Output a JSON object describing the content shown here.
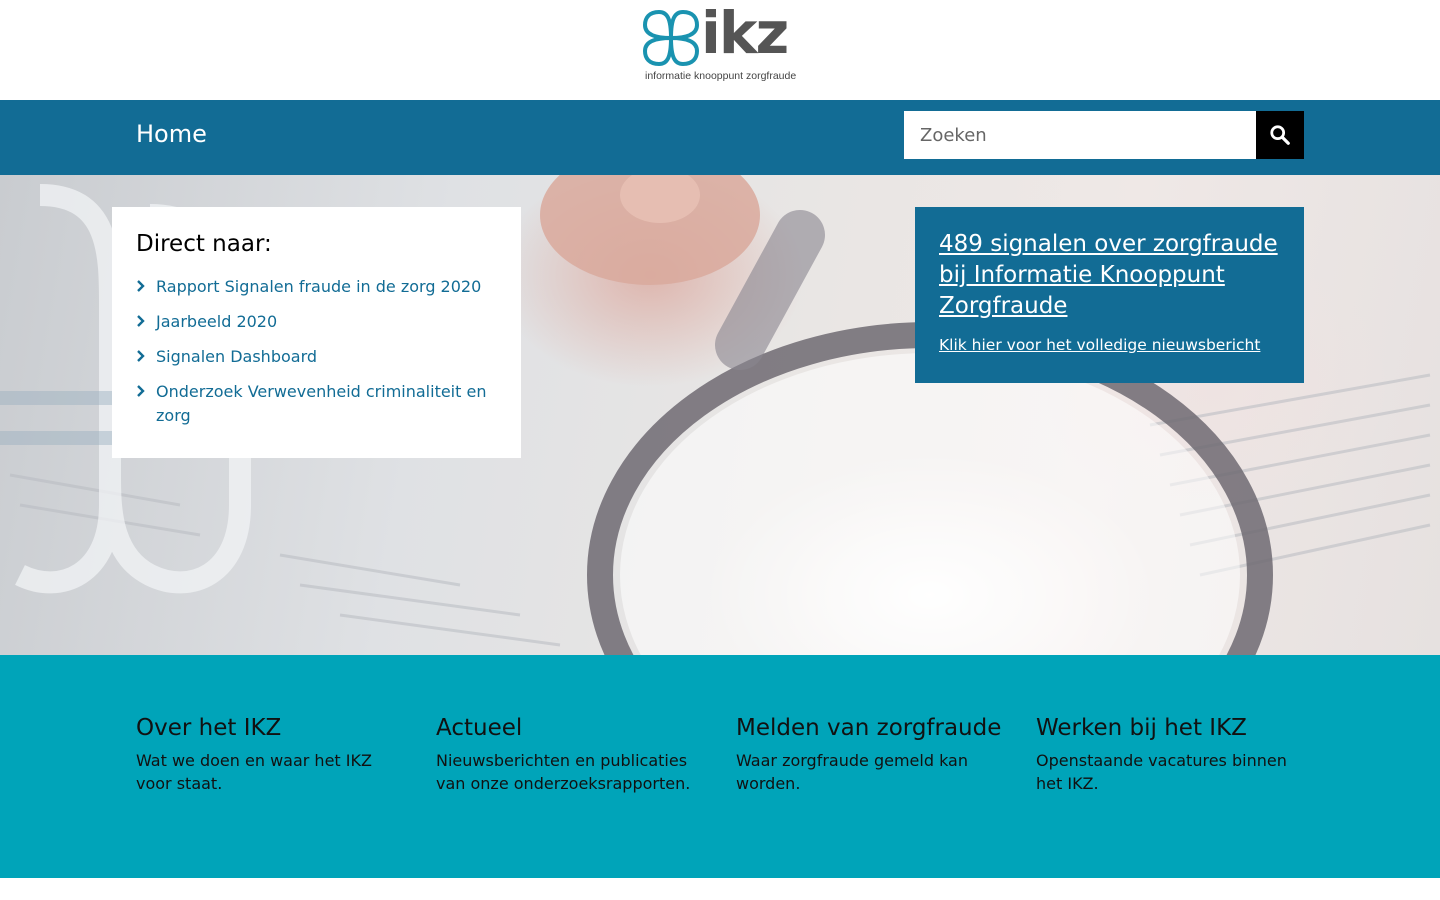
{
  "header": {
    "logo_word": "ikz",
    "logo_tagline": "informatie knooppunt zorgfraude"
  },
  "nav": {
    "home_label": "Home",
    "search_placeholder": "Zoeken"
  },
  "direct": {
    "title": "Direct naar:",
    "items": [
      {
        "label": "Rapport Signalen fraude in de zorg 2020"
      },
      {
        "label": "Jaarbeeld 2020"
      },
      {
        "label": "Signalen Dashboard"
      },
      {
        "label": "Onderzoek Verwevenheid criminaliteit en zorg"
      }
    ]
  },
  "news": {
    "title": "489 signalen over zorgfraude bij Informatie Knooppunt Zorgfraude",
    "link": "Klik hier voor het volledige nieuwsbericht"
  },
  "footer_columns": [
    {
      "title": "Over het IKZ",
      "text": "Wat we doen en waar het IKZ voor staat."
    },
    {
      "title": "Actueel",
      "text": "Nieuwsberichten en publicaties van onze onderzoeksrapporten."
    },
    {
      "title": "Melden van zorgfraude",
      "text": "Waar zorgfraude gemeld kan worden."
    },
    {
      "title": "Werken bij het IKZ",
      "text": "Openstaande vacatures binnen het IKZ."
    }
  ],
  "colors": {
    "nav_blue": "#126c95",
    "teal": "#00a4b9",
    "link_blue": "#126c95"
  },
  "icons": {
    "search": "search-icon",
    "chevron": "chevron-right-icon",
    "logo_mark": "ikz-logo-mark"
  }
}
